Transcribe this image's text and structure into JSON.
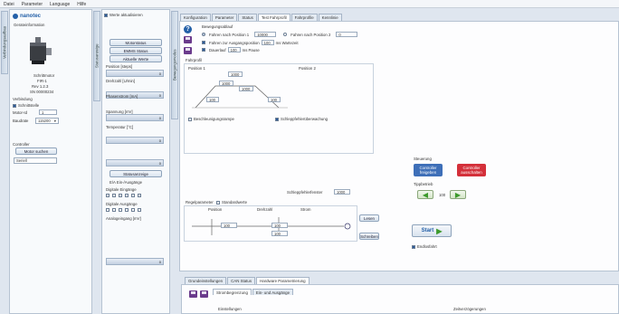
{
  "menu": [
    "Datei",
    "Parameter",
    "Language",
    "Hilfe"
  ],
  "left_vtab": "Verbindungsaufbau",
  "device": {
    "brand": "nanotec",
    "section_title": "Gerateinformation",
    "model": "Schrittmotor",
    "firmware": "FIR-1",
    "hw": "Rev 1.2.3",
    "serial": "SN 00000234",
    "conn_title": "Verbindung",
    "conn_auto": "Schnittstelle",
    "motor_id_label": "Motor-Id",
    "motor_id_value": "1",
    "baud_label": "Baudrate",
    "baud_value": "115200",
    "controller_title": "Controller",
    "search_btn": "Motor suchen",
    "serial_label": "Seriell"
  },
  "status_vtab": "Statusanzeige",
  "status": {
    "auto_check": "Werte aktualisieren",
    "btn_motor": "Motorstatus",
    "btn_error": "EMMS Status",
    "btn_values": "Aktuelle Werte",
    "pos_label": "Position [steps]",
    "pos_value": "0",
    "speed_label": "Drehzahl [U/min]",
    "speed_value": "0",
    "current_label": "Phasenstrom [mA]",
    "current_value": "0",
    "voltage_label": "Spannung [mV]",
    "voltage_value": "0",
    "temp_label": "Temperatur [°C]",
    "temp_value": "0",
    "btn_io": "Statusanzeige",
    "btn_io2": "E/A Ein-/Ausgänge",
    "di_label": "Digitale Eingänge",
    "do_label": "Digitale Ausgänge",
    "ai_label": "Analogeingang [mV]",
    "ai_value": "0"
  },
  "right_vtab": "Bewegungsmodus",
  "tabs": [
    "Konfiguration",
    "Parameter",
    "Status",
    "Test Fahrprofil",
    "Fahrprofile",
    "Kennlinie"
  ],
  "active_tab": 3,
  "motion": {
    "header": "Bewegungsablauf",
    "opt1": "Fahren nach Position 1",
    "opt1_val": "10000",
    "opt2": "Fahren nach Position 2",
    "opt2_val": "0",
    "line2": "Fahren zur Ausgangsposition",
    "line2_val": "100",
    "line2_tail": "ms Wartezeit",
    "line3": "Dauerlauf",
    "line3_val": "100",
    "line3_tail": "ms Pause"
  },
  "profile": {
    "header": "Fahrprofil",
    "col1": "Position 1",
    "col2": "Position 2",
    "val_top": "1000",
    "val_mid_l": "1000",
    "val_mid_r": "1000",
    "val_bot_l": "100",
    "val_bot_r": "100",
    "chk1": "Beschleunigungsrampe",
    "chk2": "Schleppfehlerüberwachung"
  },
  "drift": {
    "label": "Schleppfehlerfenster",
    "value": "1000"
  },
  "control": {
    "header": "Regelparameter",
    "check": "Standardwerte",
    "col_pos": "Position",
    "col_speed": "Drehzahl",
    "col_current": "Strom",
    "v1": "100",
    "v2": "100",
    "v3": "100",
    "read_btn": "Lesen",
    "write_btn": "Schreiben"
  },
  "controls": {
    "title": "Steuerung",
    "btn_blue": "Controller freigeben",
    "btn_red": "Controller ausschalten",
    "step_title": "Tippbetrieb",
    "step_value": "100",
    "start_btn": "Start",
    "auto_check": "Endlosfahrt"
  },
  "bottom_tabs": [
    "Grundeinstellungen",
    "CAN Status",
    "Hardware Parametrierung"
  ],
  "bottom_active": 2,
  "bottom_inner_tabs": [
    "Strombegrenzung",
    "Ein- und Ausgänge"
  ],
  "bottom_row_label": "Einstellungen",
  "bottom_row_right": "Zeitverzögerungen",
  "colors": {
    "accent_blue": "#2460a8",
    "red_btn": "#d4303a",
    "blue_btn": "#3e6fb8",
    "green": "#3d9a2c"
  }
}
